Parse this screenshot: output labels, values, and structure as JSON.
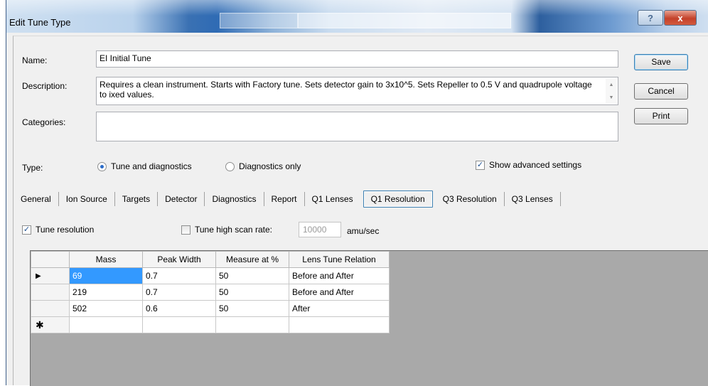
{
  "window": {
    "title": "Edit Tune Type",
    "controls": {
      "help": "?",
      "close": "x"
    }
  },
  "form": {
    "name_label": "Name:",
    "name_value": "EI Initial Tune",
    "description_label": "Description:",
    "description_value": "Requires a clean instrument. Starts with Factory tune. Sets detector gain to 3x10^5. Sets Repeller to 0.5 V and quadrupole voltage to ixed values.",
    "categories_label": "Categories:",
    "categories_value": ""
  },
  "buttons": {
    "save": "Save",
    "cancel": "Cancel",
    "print": "Print"
  },
  "type": {
    "label": "Type:",
    "options": [
      {
        "label": "Tune and diagnostics",
        "checked": true
      },
      {
        "label": "Diagnostics only",
        "checked": false
      }
    ],
    "advanced_label": "Show advanced settings",
    "advanced_checked": true
  },
  "tabs": [
    {
      "label": "General"
    },
    {
      "label": "Ion Source"
    },
    {
      "label": "Targets"
    },
    {
      "label": "Detector"
    },
    {
      "label": "Diagnostics"
    },
    {
      "label": "Report"
    },
    {
      "label": "Q1 Lenses"
    },
    {
      "label": "Q1 Resolution",
      "selected": true
    },
    {
      "label": "Q3 Resolution"
    },
    {
      "label": "Q3 Lenses"
    }
  ],
  "resolution": {
    "tune_resolution_label": "Tune resolution",
    "tune_resolution_checked": true,
    "high_scan_label": "Tune high scan rate:",
    "high_scan_checked": false,
    "scan_rate_value": "10000",
    "scan_rate_unit": "amu/sec"
  },
  "grid": {
    "columns": [
      "Mass",
      "Peak Width",
      "Measure at %",
      "Lens Tune Relation"
    ],
    "rows": [
      {
        "marker": "▶",
        "mass": "69",
        "peak": "0.7",
        "measure": "50",
        "relation": "Before and After"
      },
      {
        "marker": "",
        "mass": "219",
        "peak": "0.7",
        "measure": "50",
        "relation": "Before and After"
      },
      {
        "marker": "",
        "mass": "502",
        "peak": "0.6",
        "measure": "50",
        "relation": "After"
      }
    ],
    "new_row_marker": "✱"
  },
  "colors": {
    "selection": "#3399ff",
    "grid_background": "#a9a9a9",
    "dialog_background": "#f0f0f0"
  }
}
